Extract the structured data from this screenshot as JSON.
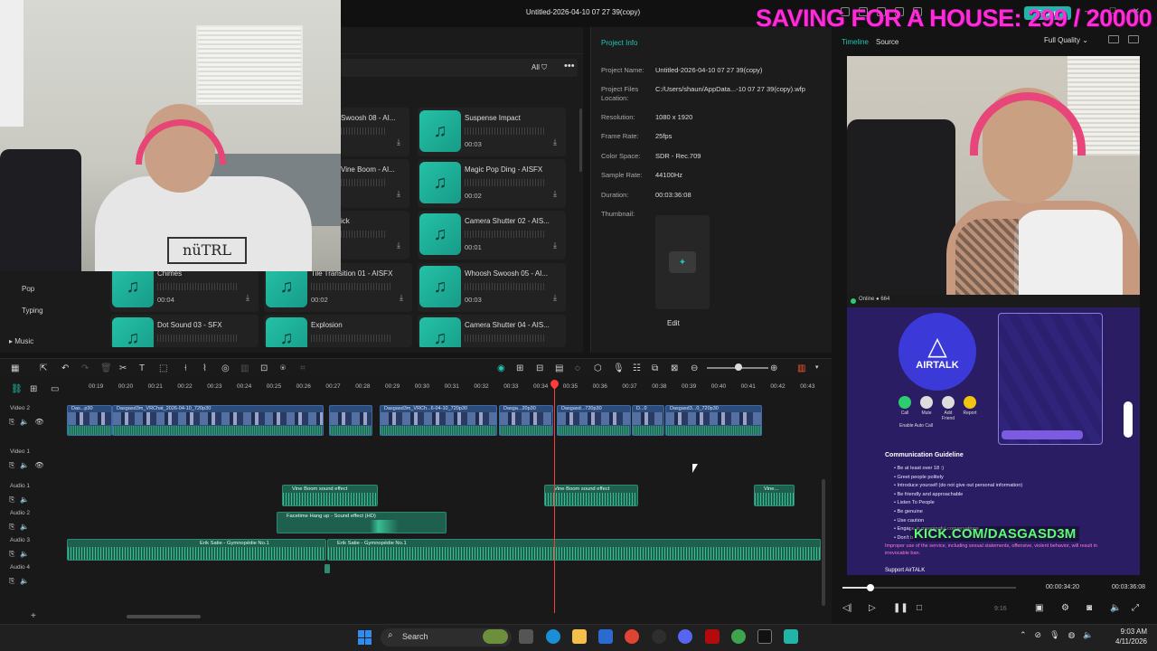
{
  "window": {
    "title": "Untitled-2026-04-10 07 27 39(copy)",
    "export_label": "Export"
  },
  "overlay": {
    "banner": "SAVING FOR A HOUSE: 299 / 20000"
  },
  "media_panel": {
    "filter_label": "All",
    "categories": [
      "Pop",
      "Typing",
      "Music"
    ],
    "webcam_shirt_text": "nüTRL",
    "sound_effects": [
      {
        "name": "Swoosh 08 - AI...",
        "duration": ""
      },
      {
        "name": "Suspense Impact",
        "duration": "00:03"
      },
      {
        "name": "Vine Boom - AI...",
        "duration": ""
      },
      {
        "name": "Magic Pop Ding - AISFX",
        "duration": "00:02"
      },
      {
        "name": "ick",
        "duration": ""
      },
      {
        "name": "Camera Shutter 02 - AIS...",
        "duration": "00:01"
      },
      {
        "name": "Chimes",
        "duration": "00:04"
      },
      {
        "name": "Tile Transition 01 - AISFX",
        "duration": "00:02"
      },
      {
        "name": "Whoosh Swoosh 05 - AI...",
        "duration": "00:03"
      },
      {
        "name": "Dot Sound 03 - SFX",
        "duration": ""
      },
      {
        "name": "Explosion",
        "duration": ""
      },
      {
        "name": "Camera Shutter 04 - AIS...",
        "duration": ""
      }
    ]
  },
  "project_info": {
    "title": "Project Info",
    "name_label": "Project Name:",
    "name": "Untitled-2026-04-10 07 27 39(copy)",
    "location_label": "Project Files Location:",
    "location": "C:/Users/shaun/AppData...-10 07 27 39(copy).wfp",
    "resolution_label": "Resolution:",
    "resolution": "1080 x 1920",
    "frame_rate_label": "Frame Rate:",
    "frame_rate": "25fps",
    "color_space_label": "Color Space:",
    "color_space": "SDR - Rec.709",
    "sample_rate_label": "Sample Rate:",
    "sample_rate": "44100Hz",
    "duration_label": "Duration:",
    "duration": "00:03:36:08",
    "thumbnail_label": "Thumbnail:",
    "edit_label": "Edit"
  },
  "preview": {
    "tab_timeline": "Timeline",
    "tab_source": "Source",
    "quality": "Full Quality",
    "current_time": "00:00:34:20",
    "total_time": "00:03:36:08",
    "progress_fraction": 0.16,
    "ratio": "9:16",
    "airtalk": {
      "online": "Online",
      "count": "664",
      "brand": "AIRTALK",
      "actions": [
        "Call",
        "Mute",
        "Add Friend",
        "Report"
      ],
      "auto_call": "Enable Auto Call",
      "guide_title": "Communication Guideline",
      "guidelines": [
        "Be at least over 18 :)",
        "Greet people politely",
        "Introduce yourself (do not give out personal information)",
        "Be friendly and approachable",
        "Listen To People",
        "Be genuine",
        "Use caution",
        "Engage in meaningful conversations",
        "Don't b"
      ],
      "kick_url": "KICK.COM/DASGASD3M",
      "warning": "Improper use of the service, including sexual statements, offensive, violent behavior, will result in irrevocable ban.",
      "support": "Support AirTALK"
    }
  },
  "timeline": {
    "ruler": [
      "00:19",
      "00:20",
      "00:21",
      "00:22",
      "00:23",
      "00:24",
      "00:25",
      "00:26",
      "00:27",
      "00:28",
      "00:29",
      "00:30",
      "00:31",
      "00:32",
      "00:33",
      "00:34",
      "00:35",
      "00:36",
      "00:37",
      "00:38",
      "00:39",
      "00:40",
      "00:41",
      "00:42",
      "00:43"
    ],
    "tracks": [
      "Video 2",
      "Video 1",
      "Audio 1",
      "Audio 2",
      "Audio 3",
      "Audio 4"
    ],
    "video_clips": [
      "Das...p30",
      "Dasgasd3m_VRChat_2026-04-10_720p30",
      "Dasgasd3m_VRCh...6-04-10_720p30",
      "Dasga...20p30",
      "Dasgasd...720p30",
      "D...0",
      "Dasgasd3...0_720p30"
    ],
    "audio_clips": {
      "a1": [
        "Vine Boom sound effect",
        "Vine Boom sound effect",
        "Vine..."
      ],
      "a2": [
        "Facetime Hang up - Sound effect (HD)"
      ],
      "a3": [
        "Erik Satie - Gymnopédie No.1",
        "Erik Satie - Gymnopédie No.1"
      ]
    }
  },
  "taskbar": {
    "search_label": "Search",
    "time": "9:03 AM",
    "date": "4/11/2026"
  },
  "colors": {
    "accent": "#1fc6b2",
    "banner": "#ff2bd6",
    "playhead": "#ff3b3b",
    "kick": "#57ff6a"
  }
}
